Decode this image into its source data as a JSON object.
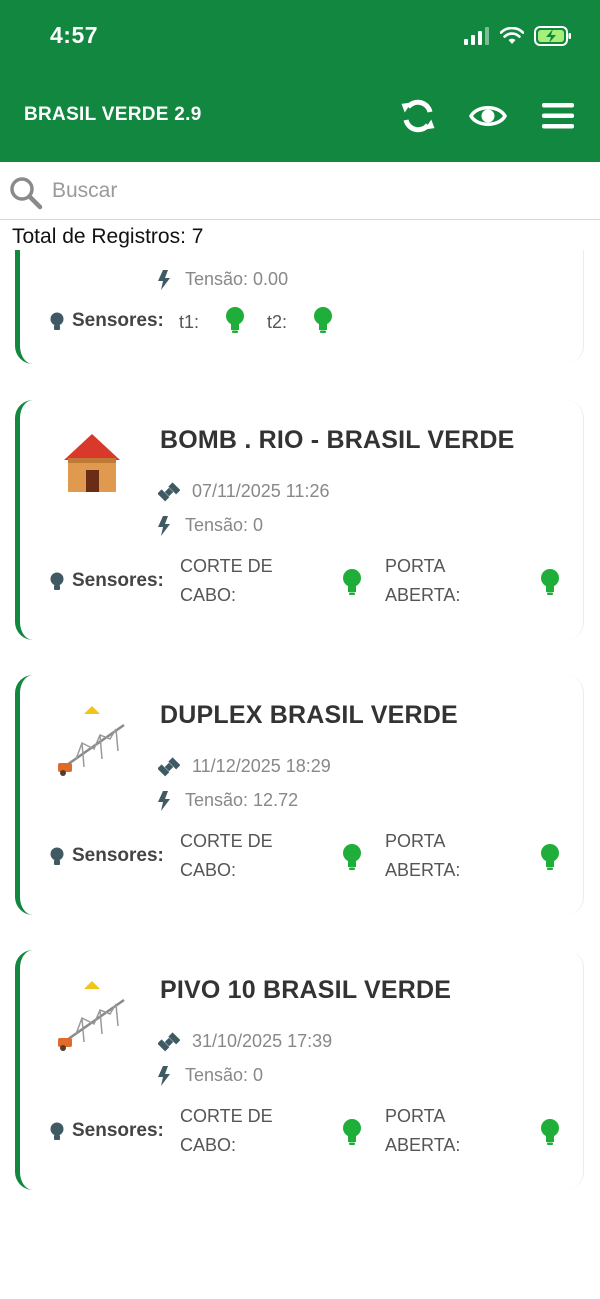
{
  "status_bar": {
    "time": "4:57"
  },
  "header": {
    "title": "BRASIL VERDE 2.9",
    "refresh_icon": "refresh-icon",
    "eye_icon": "eye-icon",
    "menu_icon": "menu-icon"
  },
  "search": {
    "placeholder": "Buscar",
    "value": ""
  },
  "total": "Total de Registros: 7",
  "colors": {
    "brand": "#12873f",
    "bulb_on": "#1fae3a"
  },
  "partial_card": {
    "tension": "Tensão: 0.00",
    "sensors_label": "Sensores:",
    "sensors": [
      {
        "name": "t1:"
      },
      {
        "name": "t2:"
      }
    ]
  },
  "cards": [
    {
      "title": "BOMB . RIO - BRASIL VERDE",
      "icon": "house-icon",
      "timestamp": "07/11/2025 11:26",
      "tension": "Tensão: 0",
      "sensors_label": "Sensores:",
      "sensors": [
        {
          "name": "CORTE DE CABO:"
        },
        {
          "name": "PORTA ABERTA:"
        }
      ]
    },
    {
      "title": "DUPLEX BRASIL VERDE",
      "icon": "center-pivot-icon",
      "timestamp": "11/12/2025 18:29",
      "tension": "Tensão: 12.72",
      "sensors_label": "Sensores:",
      "sensors": [
        {
          "name": "CORTE DE CABO:"
        },
        {
          "name": "PORTA ABERTA:"
        }
      ]
    },
    {
      "title": "PIVO 10 BRASIL VERDE",
      "icon": "center-pivot-icon",
      "timestamp": "31/10/2025 17:39",
      "tension": "Tensão: 0",
      "sensors_label": "Sensores:",
      "sensors": [
        {
          "name": "CORTE DE CABO:"
        },
        {
          "name": "PORTA ABERTA:"
        }
      ]
    }
  ]
}
